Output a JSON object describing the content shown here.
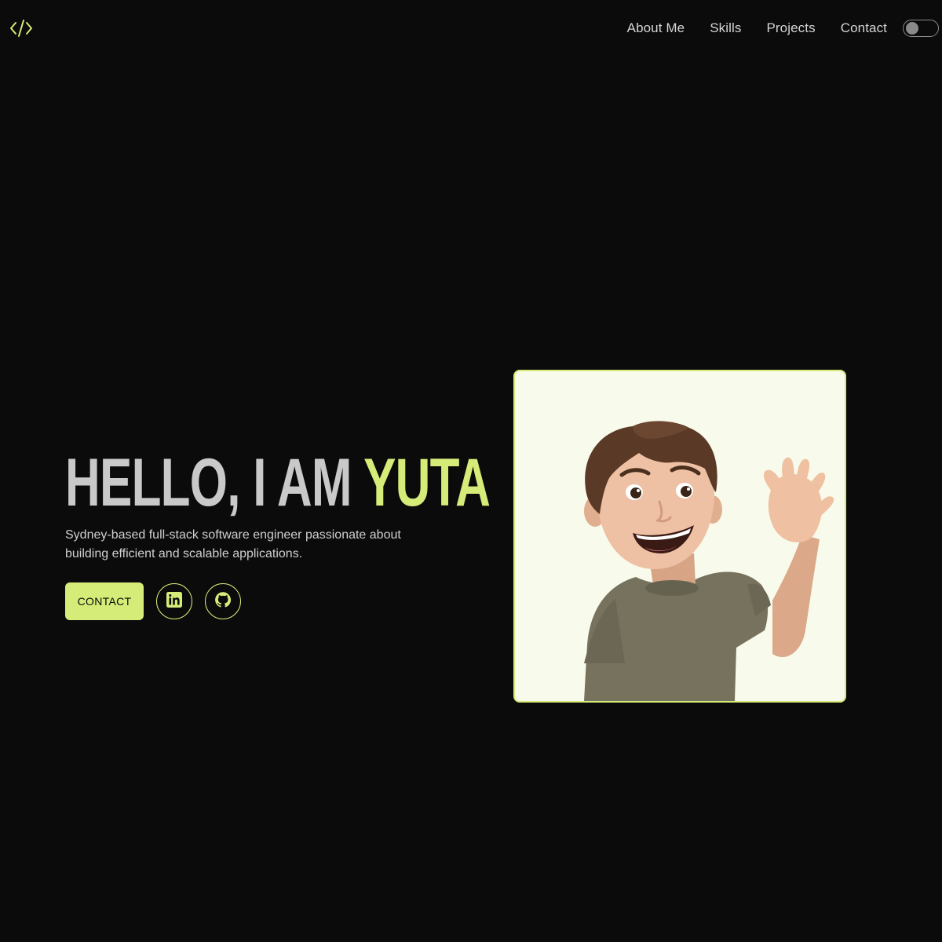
{
  "header": {
    "logo_icon": "code-brackets-icon",
    "nav": [
      {
        "label": "About Me"
      },
      {
        "label": "Skills"
      },
      {
        "label": "Projects"
      },
      {
        "label": "Contact"
      }
    ],
    "theme_toggle": {
      "icon": "toggle-switch",
      "state": "off"
    }
  },
  "hero": {
    "title_prefix": "HELLO, I AM ",
    "title_name": "YUTA",
    "description": "Sydney-based full-stack software engineer passionate about building efficient and scalable applications.",
    "contact_label": "CONTACT",
    "social": [
      {
        "icon": "linkedin-icon"
      },
      {
        "icon": "github-icon"
      }
    ]
  },
  "avatar": {
    "icon": "waving-memoji-avatar"
  },
  "colors": {
    "background": "#0b0b0b",
    "accent": "#d6ec79",
    "text": "#d4d4d4",
    "card_bg": "#f8fbeb"
  }
}
